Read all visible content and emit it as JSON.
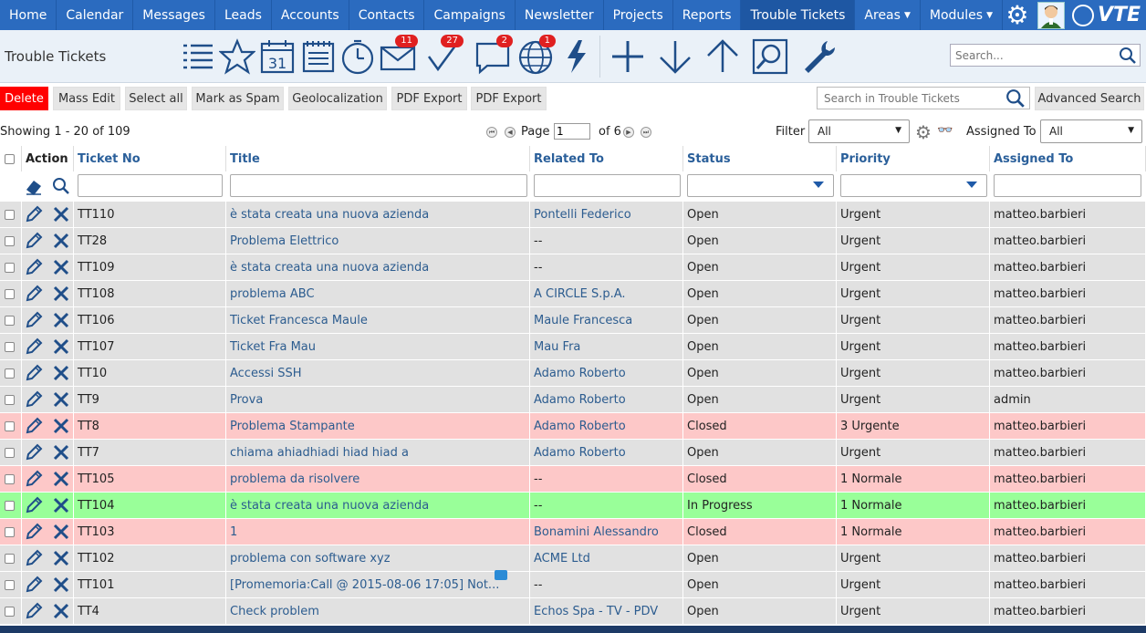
{
  "nav": {
    "items": [
      "Home",
      "Calendar",
      "Messages",
      "Leads",
      "Accounts",
      "Contacts",
      "Campaigns",
      "Newsletter",
      "Projects",
      "Reports",
      "Trouble Tickets",
      "Areas",
      "Modules"
    ],
    "active": "Trouble Tickets",
    "brand": "VTE"
  },
  "module": {
    "title": "Trouble Tickets",
    "badges": {
      "mail": "11",
      "tasks": "27",
      "chat": "2",
      "globe": "1"
    },
    "search_placeholder": "Search..."
  },
  "actions": {
    "buttons": [
      "Delete",
      "Mass Edit",
      "Select all",
      "Mark as Spam",
      "Geolocalization",
      "PDF Export",
      "PDF Export"
    ],
    "list_search_placeholder": "Search in Trouble Tickets",
    "advanced_search": "Advanced Search"
  },
  "paging": {
    "showing": "Showing 1 - 20 of 109",
    "page_label": "Page",
    "page_value": "1",
    "of_label": "of 6",
    "filter_label": "Filter",
    "filter_value": "All",
    "assigned_label": "Assigned To",
    "assigned_value": "All"
  },
  "table": {
    "columns": [
      "Action",
      "Ticket No",
      "Title",
      "Related To",
      "Status",
      "Priority",
      "Assigned To"
    ],
    "rows": [
      {
        "ticket": "TT110",
        "title": "è stata creata una nuova azienda",
        "related": "Pontelli Federico",
        "status": "Open",
        "priority": "Urgent",
        "assigned": "matteo.barbieri",
        "style": "normal"
      },
      {
        "ticket": "TT28",
        "title": "Problema Elettrico",
        "related": "--",
        "status": "Open",
        "priority": "Urgent",
        "assigned": "matteo.barbieri",
        "style": "normal"
      },
      {
        "ticket": "TT109",
        "title": "è stata creata una nuova azienda",
        "related": "--",
        "status": "Open",
        "priority": "Urgent",
        "assigned": "matteo.barbieri",
        "style": "normal"
      },
      {
        "ticket": "TT108",
        "title": "problema ABC",
        "related": "A CIRCLE S.p.A.",
        "status": "Open",
        "priority": "Urgent",
        "assigned": "matteo.barbieri",
        "style": "normal"
      },
      {
        "ticket": "TT106",
        "title": "Ticket Francesca Maule",
        "related": "Maule Francesca",
        "status": "Open",
        "priority": "Urgent",
        "assigned": "matteo.barbieri",
        "style": "normal"
      },
      {
        "ticket": "TT107",
        "title": "Ticket Fra Mau",
        "related": "Mau Fra",
        "status": "Open",
        "priority": "Urgent",
        "assigned": "matteo.barbieri",
        "style": "normal"
      },
      {
        "ticket": "TT10",
        "title": "Accessi SSH",
        "related": "Adamo Roberto",
        "status": "Open",
        "priority": "Urgent",
        "assigned": "matteo.barbieri",
        "style": "normal"
      },
      {
        "ticket": "TT9",
        "title": "Prova",
        "related": "Adamo Roberto",
        "status": "Open",
        "priority": "Urgent",
        "assigned": "admin",
        "style": "normal"
      },
      {
        "ticket": "TT8",
        "title": "Problema Stampante",
        "related": "Adamo Roberto",
        "status": "Closed",
        "priority": "3 Urgente",
        "assigned": "matteo.barbieri",
        "style": "closed"
      },
      {
        "ticket": "TT7",
        "title": "chiama ahiadhiadi hiad hiad a",
        "related": "Adamo Roberto",
        "status": "Open",
        "priority": "Urgent",
        "assigned": "matteo.barbieri",
        "style": "normal"
      },
      {
        "ticket": "TT105",
        "title": "problema da risolvere",
        "related": "--",
        "status": "Closed",
        "priority": "1 Normale",
        "assigned": "matteo.barbieri",
        "style": "closed"
      },
      {
        "ticket": "TT104",
        "title": "è stata creata una nuova azienda",
        "related": "--",
        "status": "In Progress",
        "priority": "1 Normale",
        "assigned": "matteo.barbieri",
        "style": "progress"
      },
      {
        "ticket": "TT103",
        "title": "1",
        "related": "Bonamini Alessandro",
        "status": "Closed",
        "priority": "1 Normale",
        "assigned": "matteo.barbieri",
        "style": "closed"
      },
      {
        "ticket": "TT102",
        "title": "problema con software xyz",
        "related": "ACME Ltd",
        "status": "Open",
        "priority": "Urgent",
        "assigned": "matteo.barbieri",
        "style": "normal"
      },
      {
        "ticket": "TT101",
        "title": "[Promemoria:Call @ 2015-08-06 17:05] Not...",
        "related": "--",
        "status": "Open",
        "priority": "Urgent",
        "assigned": "matteo.barbieri",
        "style": "normal"
      },
      {
        "ticket": "TT4",
        "title": "Check problem",
        "related": "Echos Spa - TV - PDV",
        "status": "Open",
        "priority": "Urgent",
        "assigned": "matteo.barbieri",
        "style": "normal"
      }
    ]
  },
  "colors": {
    "nav": "#2b6bbf",
    "closed_row": "#fdc8c8",
    "progress_row": "#99ff99",
    "normal_row": "#e1e1e1",
    "delete": "#ff0000"
  }
}
